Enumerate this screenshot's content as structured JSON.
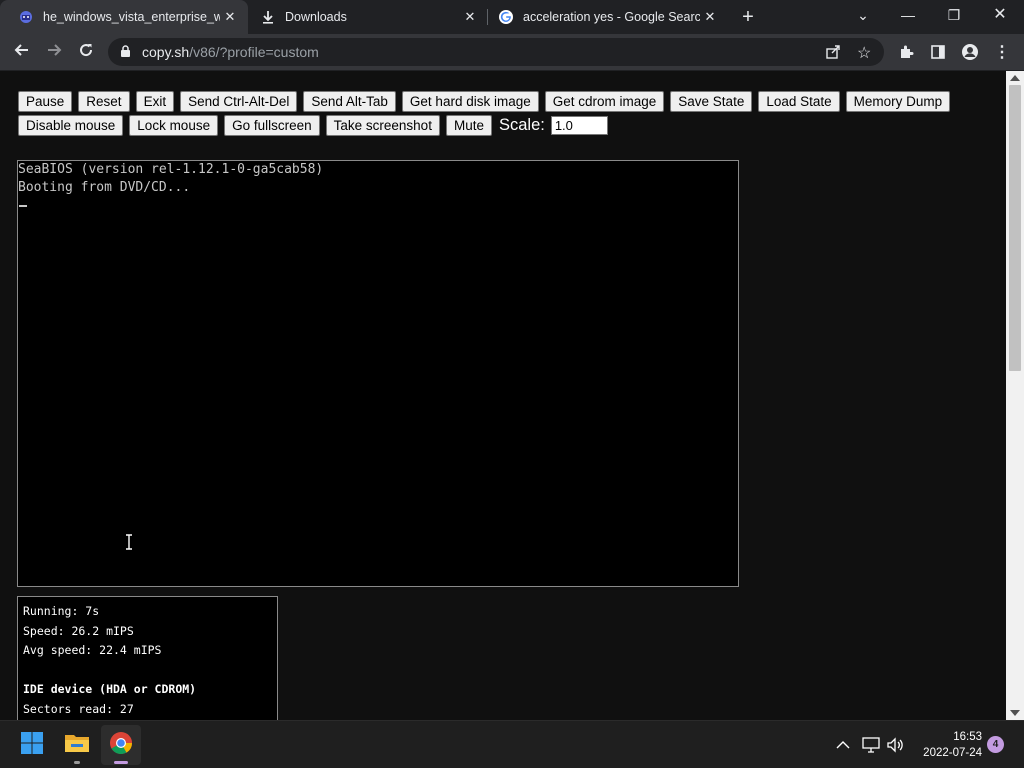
{
  "browser": {
    "tabs": [
      {
        "label": "he_windows_vista_enterprise_wit",
        "icon": "v86-favicon-icon",
        "active": true
      },
      {
        "label": "Downloads",
        "icon": "download-icon",
        "active": false
      },
      {
        "label": "acceleration yes - Google Search",
        "icon": "google-icon",
        "active": false
      }
    ],
    "url_host": "copy.sh",
    "url_path": "/v86/?profile=custom"
  },
  "toolbar": {
    "buttons_row1": [
      "Pause",
      "Reset",
      "Exit",
      "Send Ctrl-Alt-Del",
      "Send Alt-Tab",
      "Get hard disk image",
      "Get cdrom image",
      "Save State",
      "Load State",
      "Memory Dump"
    ],
    "buttons_row2": [
      "Disable mouse",
      "Lock mouse",
      "Go fullscreen",
      "Take screenshot",
      "Mute"
    ],
    "scale_label": "Scale:",
    "scale_value": "1.0"
  },
  "screen": {
    "lines": [
      "SeaBIOS (version rel-1.12.1-0-ga5cab58)",
      "Booting from DVD/CD..."
    ]
  },
  "stats": {
    "running": "Running: 7s",
    "speed": "Speed: 26.2 mIPS",
    "avg_speed": "Avg speed: 22.4 mIPS",
    "ide_heading": "IDE device (HDA or CDROM)",
    "sectors_read": "Sectors read: 27"
  },
  "taskbar": {
    "time": "16:53",
    "date": "2022-07-24",
    "notifications": "4"
  },
  "colors": {
    "tabstrip": "#202124",
    "toolbar": "#35363a",
    "page_bg": "#101010",
    "taskbar": "#1f1f1f"
  }
}
